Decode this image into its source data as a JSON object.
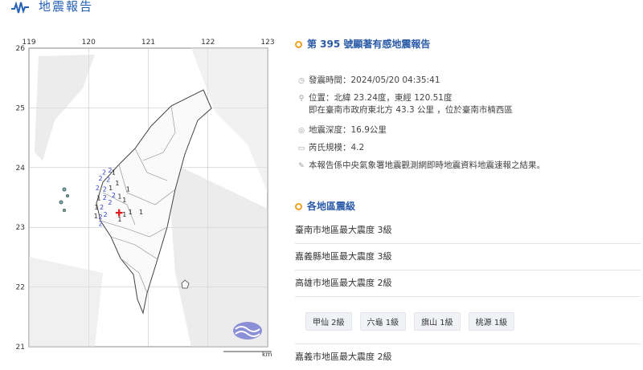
{
  "header": {
    "title": "地震報告"
  },
  "map": {
    "lon_labels": [
      "119",
      "120",
      "121",
      "122",
      "123"
    ],
    "lat_labels": [
      "26",
      "25",
      "24",
      "23",
      "22",
      "21"
    ],
    "scale_unit": "km",
    "intensity_marks": [
      {
        "v": "2",
        "lon": 120.36,
        "lat": 23.92
      },
      {
        "v": "2",
        "lon": 120.26,
        "lat": 23.88
      },
      {
        "v": "1",
        "lon": 120.42,
        "lat": 23.88
      },
      {
        "v": "2",
        "lon": 120.2,
        "lat": 23.78
      },
      {
        "v": "2",
        "lon": 120.33,
        "lat": 23.76
      },
      {
        "v": "1",
        "lon": 120.48,
        "lat": 23.7
      },
      {
        "v": "2",
        "lon": 120.15,
        "lat": 23.62
      },
      {
        "v": "2",
        "lon": 120.27,
        "lat": 23.6
      },
      {
        "v": "1",
        "lon": 120.37,
        "lat": 23.62
      },
      {
        "v": "1",
        "lon": 120.66,
        "lat": 23.6
      },
      {
        "v": "2",
        "lon": 120.42,
        "lat": 23.5
      },
      {
        "v": "1",
        "lon": 120.52,
        "lat": 23.48
      },
      {
        "v": "1",
        "lon": 120.17,
        "lat": 23.45
      },
      {
        "v": "2",
        "lon": 120.27,
        "lat": 23.46
      },
      {
        "v": "2",
        "lon": 120.36,
        "lat": 23.38
      },
      {
        "v": "1",
        "lon": 120.6,
        "lat": 23.42
      },
      {
        "v": "1",
        "lon": 120.13,
        "lat": 23.3
      },
      {
        "v": "2",
        "lon": 120.22,
        "lat": 23.3
      },
      {
        "v": "1",
        "lon": 120.7,
        "lat": 23.22
      },
      {
        "v": "1",
        "lon": 120.88,
        "lat": 23.22
      },
      {
        "v": "1",
        "lon": 120.12,
        "lat": 23.15
      },
      {
        "v": "2",
        "lon": 120.2,
        "lat": 23.14
      },
      {
        "v": "2",
        "lon": 120.28,
        "lat": 23.18
      },
      {
        "v": "1",
        "lon": 120.6,
        "lat": 23.18
      },
      {
        "v": "2",
        "lon": 120.2,
        "lat": 23.02
      },
      {
        "v": "1",
        "lon": 120.52,
        "lat": 23.1
      }
    ],
    "epicenter": {
      "lon": 120.51,
      "lat": 23.24
    }
  },
  "report": {
    "title": "第 395 號顯著有感地震報告",
    "time_text": "發震時間：2024/05/20 04:35:41",
    "location_text": "位置：北緯 23.24度，東經 120.51度",
    "location_detail": "即在臺南市政府東北方 43.3 公里 ，位於臺南市楠西區",
    "depth_text": "地震深度：16.9公里",
    "magnitude_text": "芮氏規模：4.2",
    "note": "本報告係中央氣象署地震觀測網即時地震資料地震速報之結果。"
  },
  "levels": {
    "title": "各地區震級",
    "rows": [
      "臺南市地區最大震度 3級",
      "嘉義縣地區最大震度 3級",
      "高雄市地區最大震度 2級"
    ],
    "kaohsiung_towns": [
      "甲仙 2級",
      "六龜 1級",
      "旗山 1級",
      "桃源 1級"
    ],
    "next_row": "嘉義市地區最大震度 2級"
  },
  "colors": {
    "accent": "#2a5aa8",
    "bullet": "#f0a020",
    "epicenter": "#e02020"
  }
}
